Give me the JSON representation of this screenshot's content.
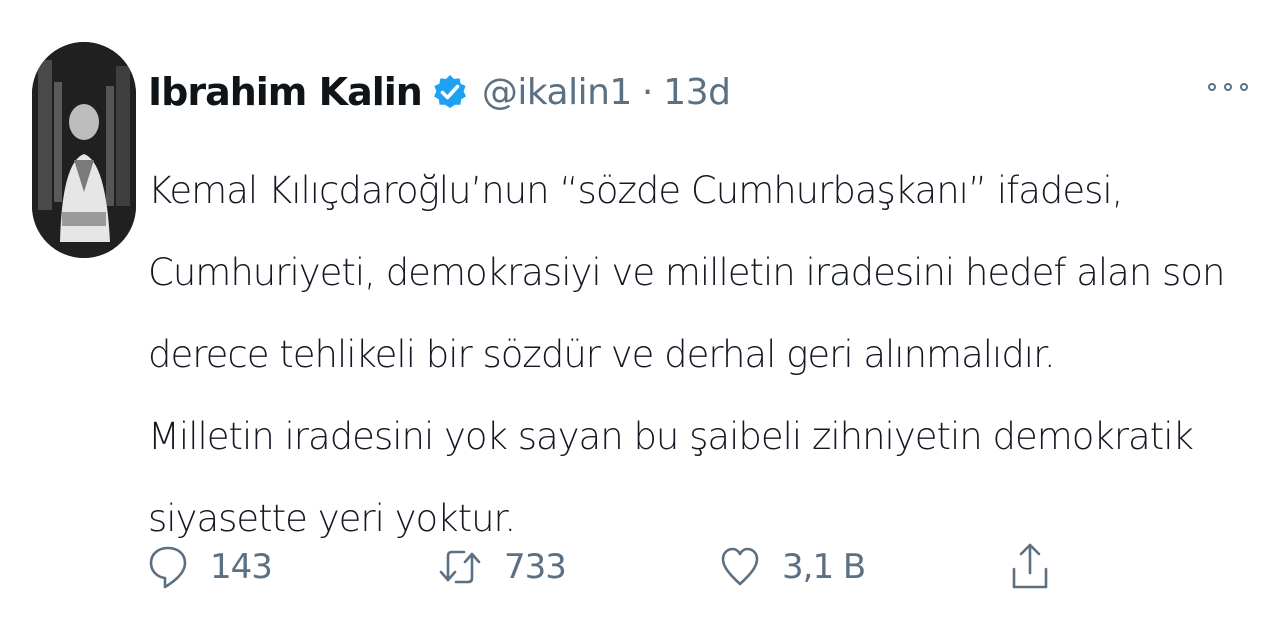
{
  "tweet": {
    "author_name": "Ibrahim Kalin",
    "handle": "@ikalin1",
    "separator": "·",
    "time": "13d",
    "text_paragraphs": [
      "Kemal Kılıçdaroğlu’nun “sözde Cumhurbaşkanı” ifadesi, Cumhuriyeti, demokrasiyi ve milletin iradesini hedef alan son derece tehlikeli bir sözdür ve derhal geri alınmalıdır.",
      "Milletin iradesini yok sayan bu şaibeli zihniyetin demokratik siyasette yeri yoktur."
    ],
    "verified_icon": "verified-badge-icon",
    "accent_color": "#1da1f2"
  },
  "actions": {
    "reply": {
      "icon": "reply-icon",
      "count": "143"
    },
    "retweet": {
      "icon": "retweet-icon",
      "count": "733"
    },
    "like": {
      "icon": "heart-icon",
      "count": "3,1 B"
    },
    "share": {
      "icon": "share-icon"
    }
  },
  "menu": {
    "icon": "more-options-icon"
  }
}
